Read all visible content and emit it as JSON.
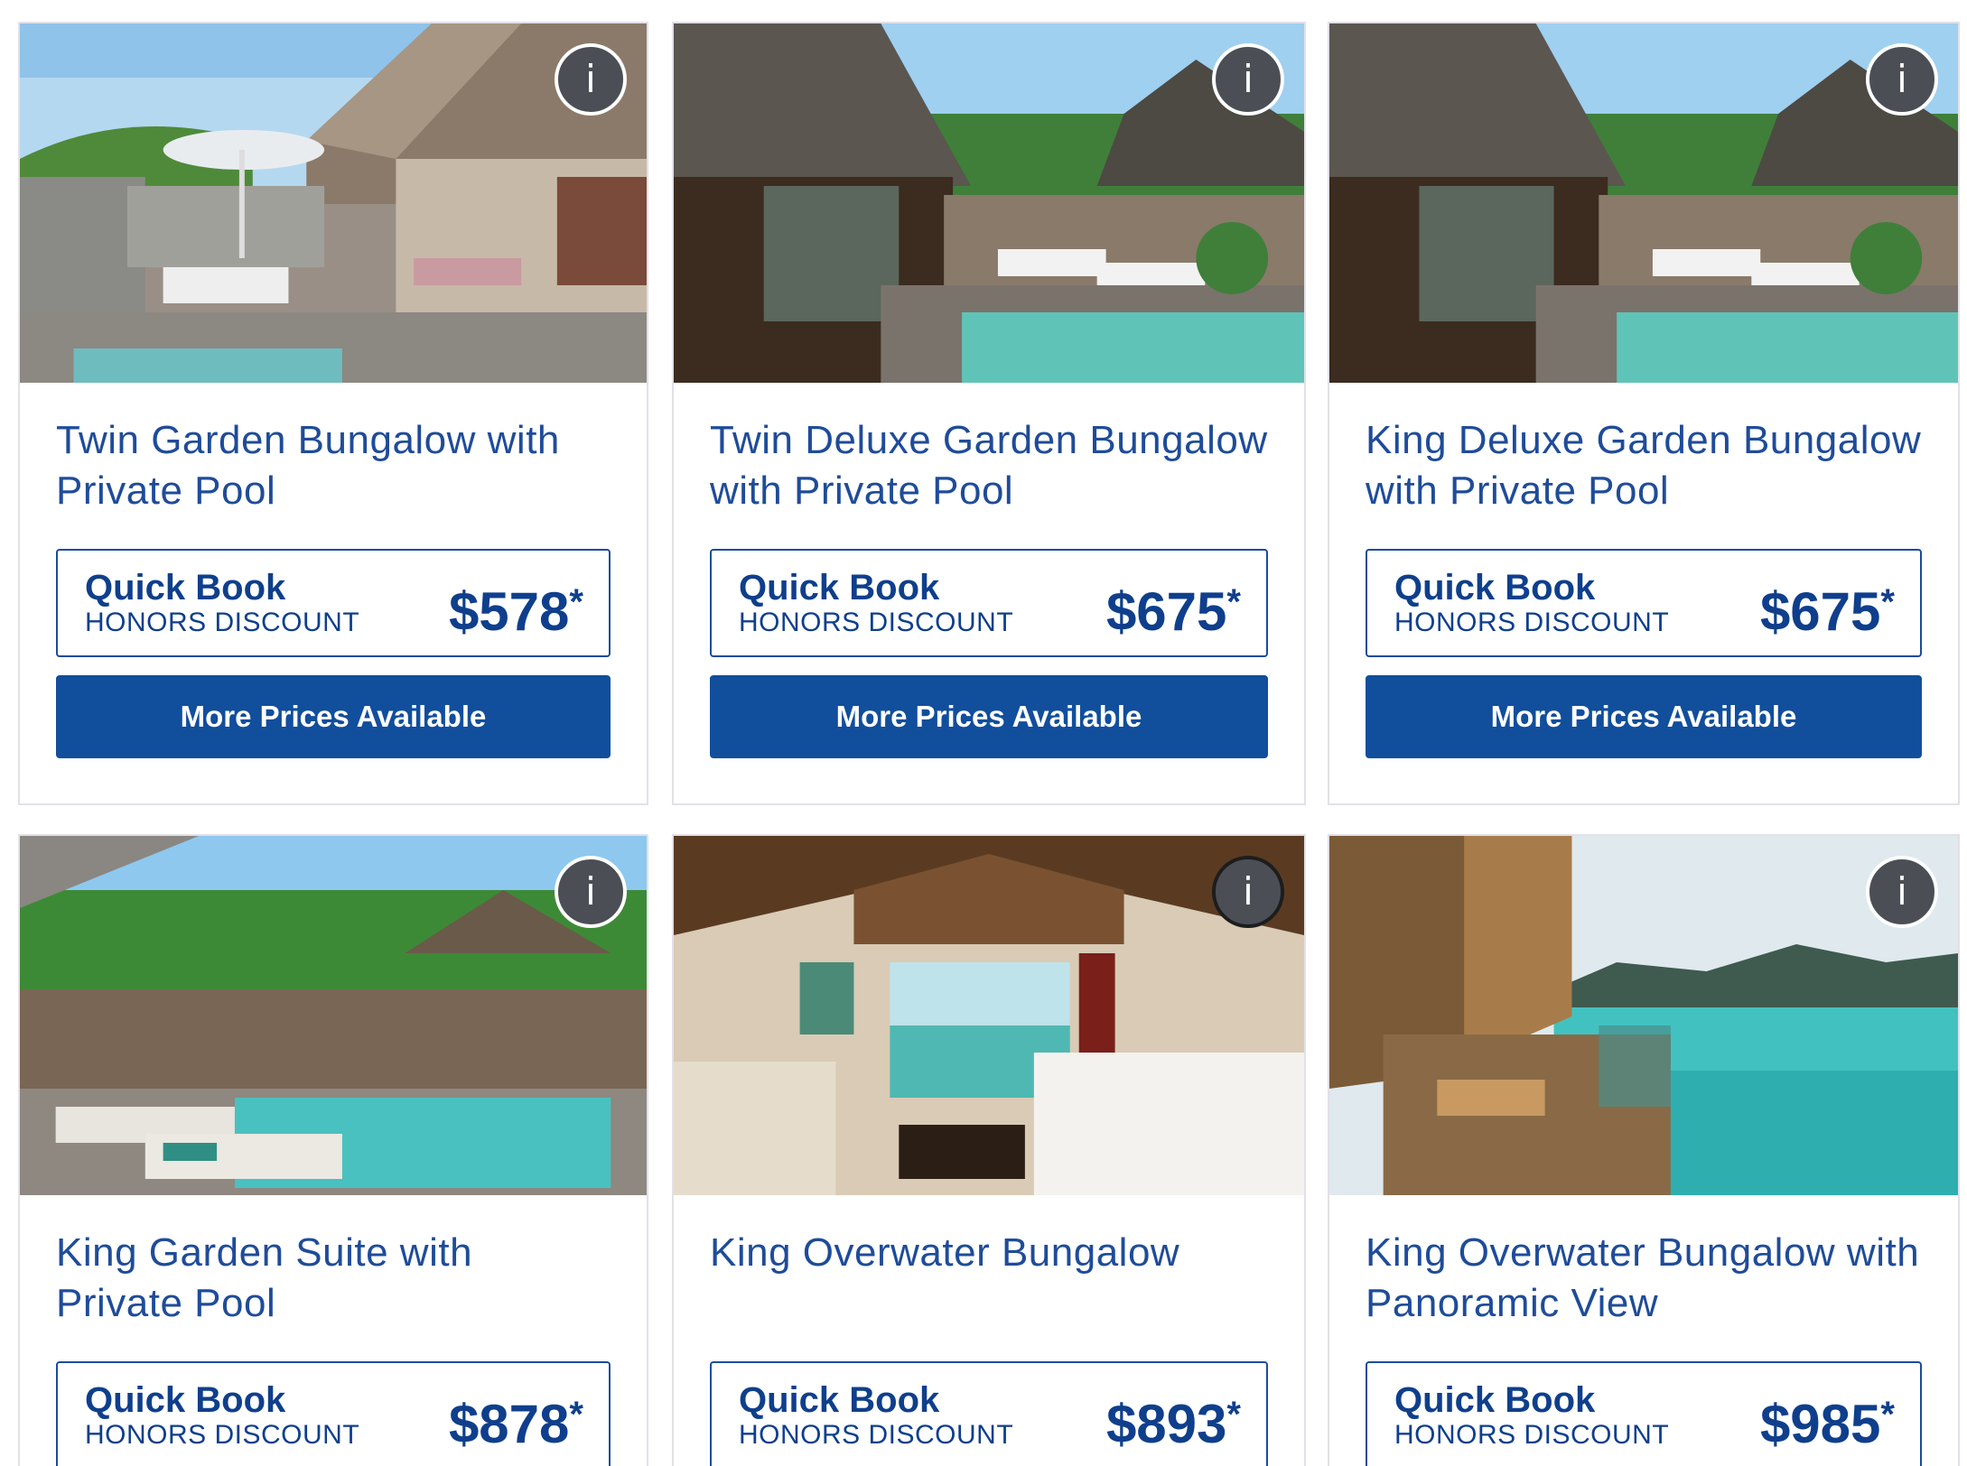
{
  "rooms": [
    {
      "title": "Twin Garden Bungalow with Private Pool",
      "quick_book": "Quick Book",
      "rate_label": "HONORS DISCOUNT",
      "price": "$578",
      "price_suffix": "*",
      "more_prices": "More Prices Available",
      "info": "i"
    },
    {
      "title": "Twin Deluxe Garden Bungalow with Private Pool",
      "quick_book": "Quick Book",
      "rate_label": "HONORS DISCOUNT",
      "price": "$675",
      "price_suffix": "*",
      "more_prices": "More Prices Available",
      "info": "i"
    },
    {
      "title": "King Deluxe Garden Bungalow with Private Pool",
      "quick_book": "Quick Book",
      "rate_label": "HONORS DISCOUNT",
      "price": "$675",
      "price_suffix": "*",
      "more_prices": "More Prices Available",
      "info": "i"
    },
    {
      "title": "King Garden Suite with Private Pool",
      "quick_book": "Quick Book",
      "rate_label": "HONORS DISCOUNT",
      "price": "$878",
      "price_suffix": "*",
      "info": "i"
    },
    {
      "title": "King Overwater Bungalow",
      "quick_book": "Quick Book",
      "rate_label": "HONORS DISCOUNT",
      "price": "$893",
      "price_suffix": "*",
      "info": "i"
    },
    {
      "title": "King Overwater Bungalow with Panoramic View",
      "quick_book": "Quick Book",
      "rate_label": "HONORS DISCOUNT",
      "price": "$985",
      "price_suffix": "*",
      "info": "i"
    }
  ],
  "icons": {
    "info": "info-icon"
  },
  "colors": {
    "brand_blue": "#114e9c",
    "title_blue": "#1f4c99",
    "card_border": "#e3e0e8",
    "info_badge": "#4b4f55"
  }
}
